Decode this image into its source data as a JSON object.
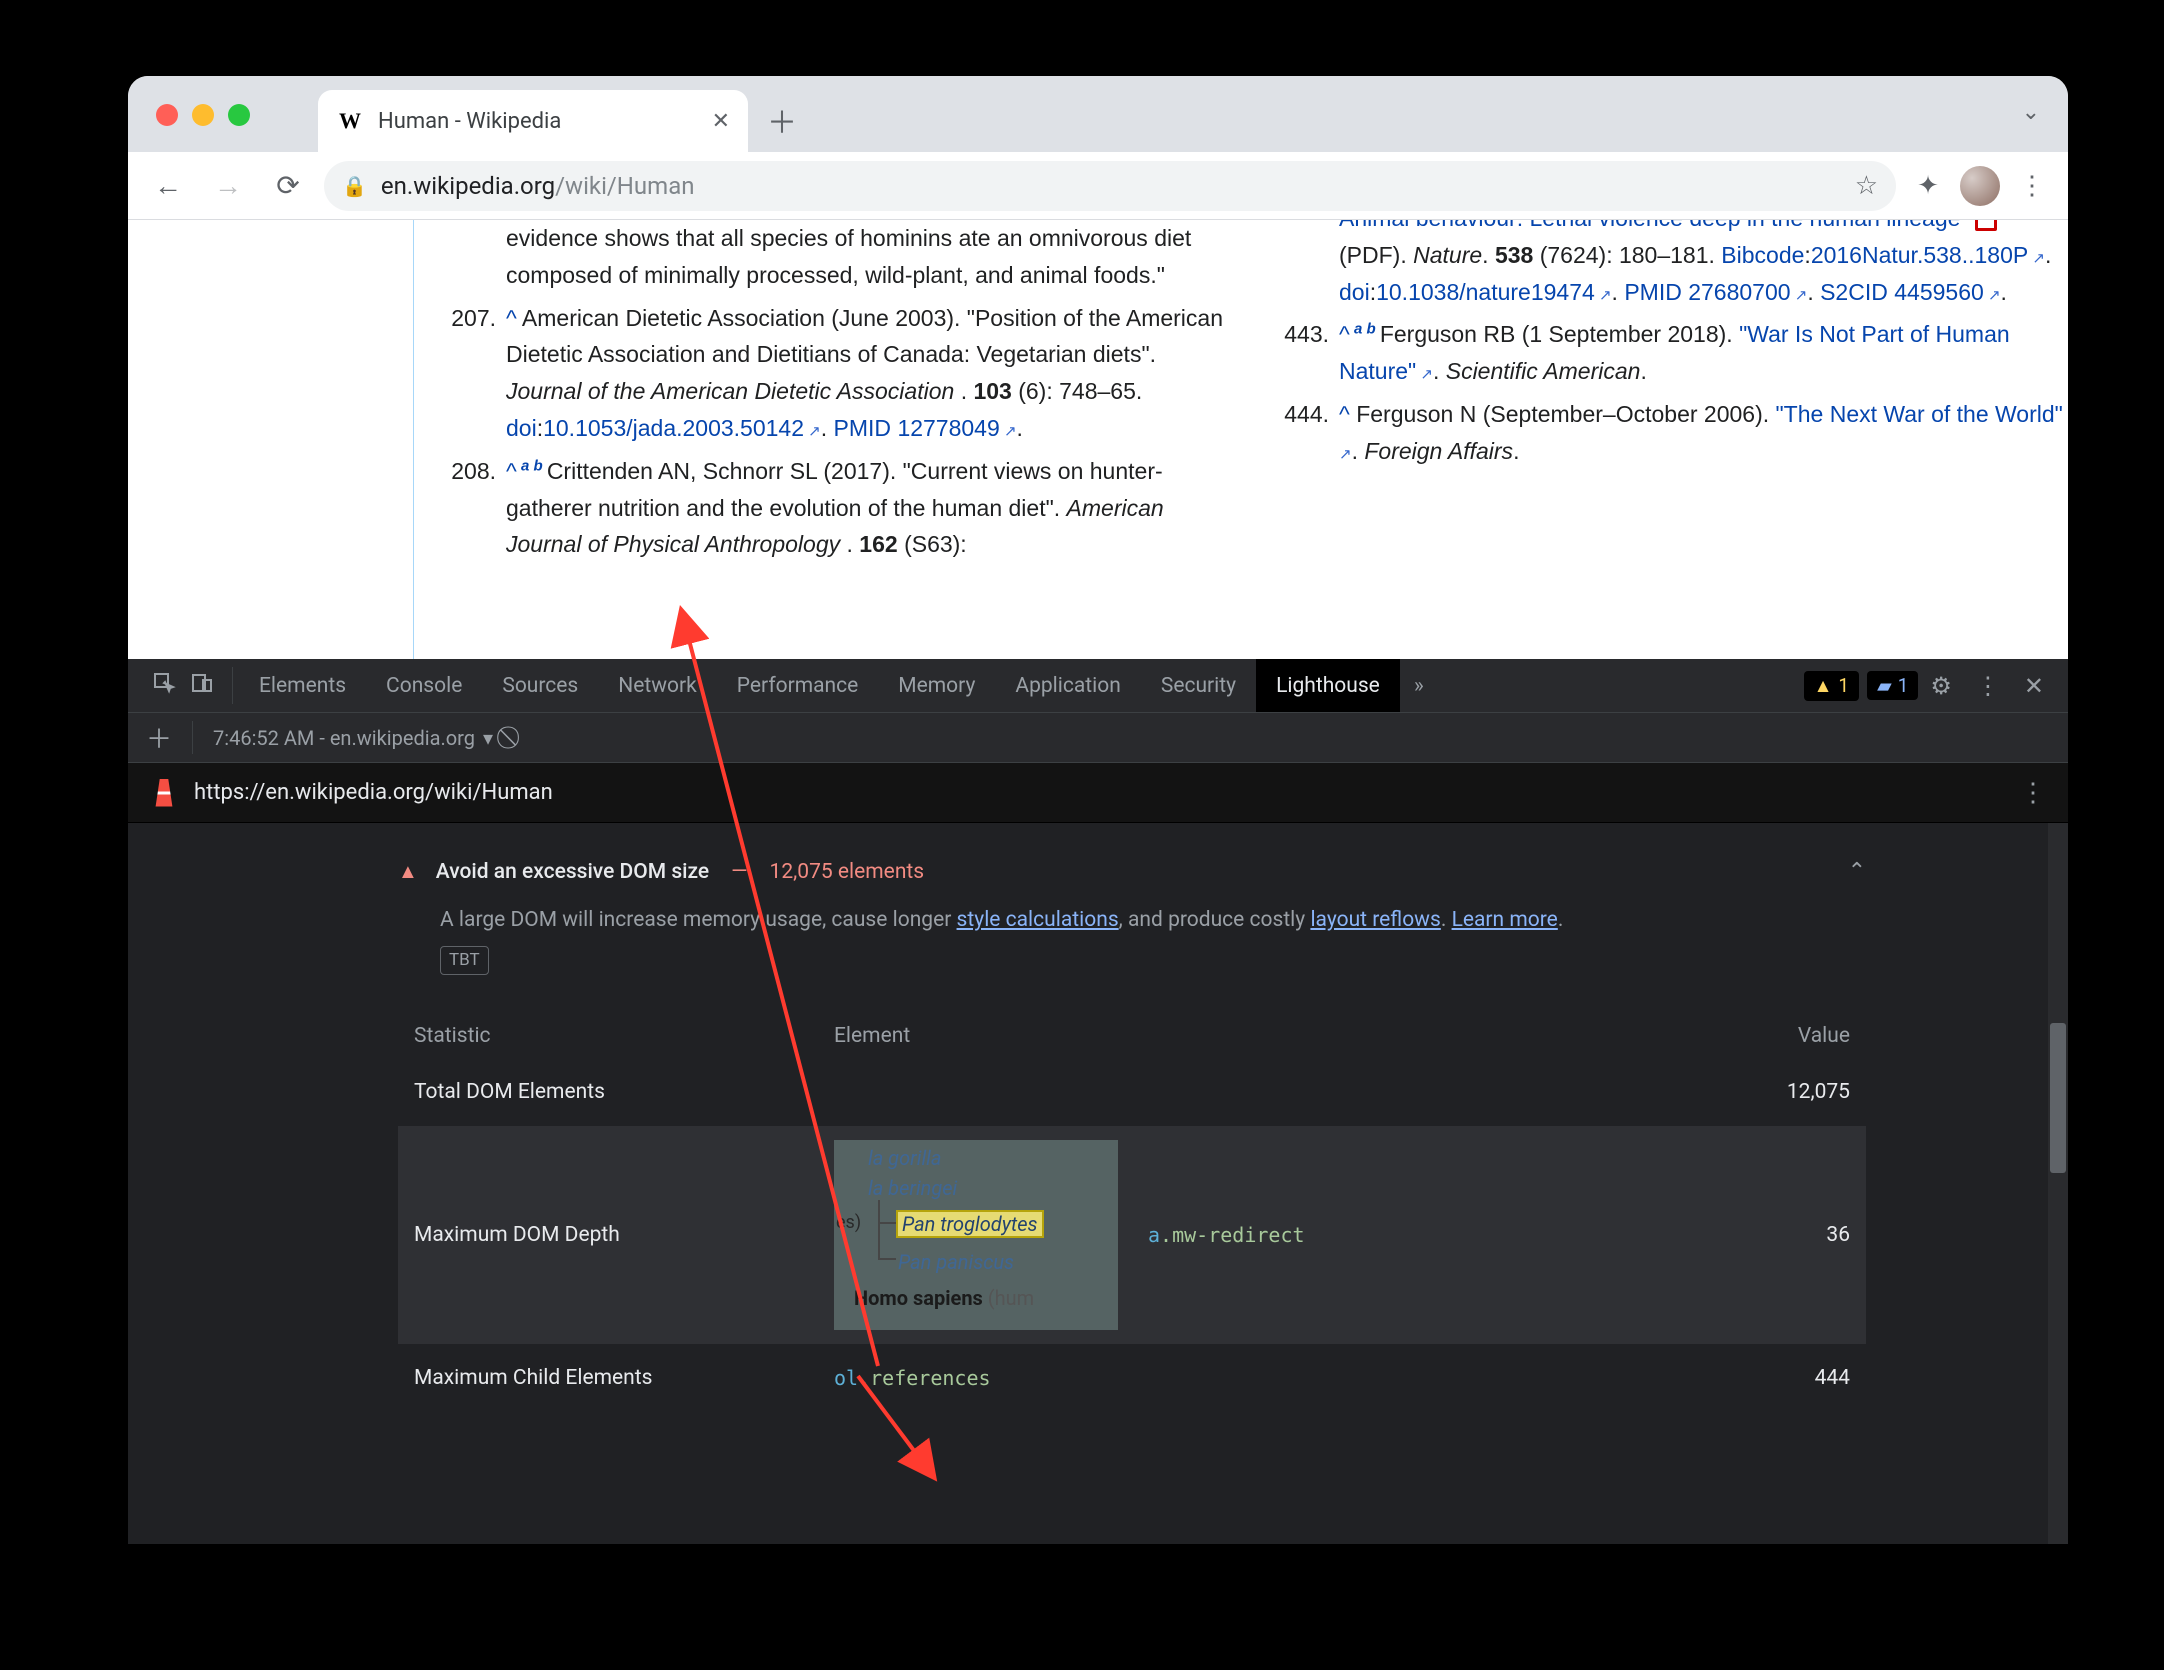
{
  "browser": {
    "tab_title": "Human - Wikipedia",
    "url_host": "en.wikipedia.org",
    "url_path": "/wiki/Human"
  },
  "wiki": {
    "left": [
      {
        "num": "",
        "text_initial": "evidence shows that all species of hominins ate an omnivorous diet composed of minimally processed, wild-plant, and animal foods.\""
      },
      {
        "num": "207.",
        "caret": "^",
        "body_a": " American Dietetic Association (June 2003). \"Position of the American Dietetic Association and Dietitians of Canada: Vegetarian diets\". ",
        "journal": "Journal of the American Dietetic Association",
        "body_b": ". ",
        "vol": "103",
        "issue_pages": " (6): 748–65. ",
        "doi_label": "doi",
        "doi_val": "10.1053/jada.2003.50142",
        "pmid_label": "PMID",
        "pmid_val": "12778049"
      },
      {
        "num": "208.",
        "caret": "^",
        "sup": " a b ",
        "body_a": "Crittenden AN, Schnorr SL (2017). \"Current views on hunter-gatherer nutrition and the evolution of the human diet\". ",
        "journal": "American Journal of Physical Anthropology",
        "body_b": ". ",
        "vol": "162",
        "issue_pages": " (S63):"
      }
    ],
    "right": [
      {
        "link1": "Animal behaviour: Lethal violence deep in the human lineage\"",
        "pdf": " (PDF). ",
        "journal": "Nature",
        "vol": "538",
        "pages": " (7624): 180–181. ",
        "bibcode_label": "Bibcode",
        "bibcode_val": "2016Natur.538..180P",
        "doi_label": "doi",
        "doi_val": "10.1038/nature19474",
        "pmid_label": "PMID",
        "pmid_val": "27680700",
        "s2cid_label": "S2CID",
        "s2cid_val": "4459560"
      },
      {
        "num": "443.",
        "caret": "^",
        "sup": " a b ",
        "author": "Ferguson RB (1 September 2018). ",
        "link": "\"War Is Not Part of Human Nature\"",
        "journal": "Scientific American"
      },
      {
        "num": "444.",
        "caret": "^",
        "author": " Ferguson N (September–October 2006). ",
        "link": "\"The Next War of the World\"",
        "journal": "Foreign Affairs"
      }
    ]
  },
  "devtools": {
    "tabs": [
      "Elements",
      "Console",
      "Sources",
      "Network",
      "Performance",
      "Memory",
      "Application",
      "Security",
      "Lighthouse"
    ],
    "active_tab": "Lighthouse",
    "warn_count": "1",
    "info_count": "1",
    "report_label": "7:46:52 AM - en.wikipedia.org",
    "lh_url": "https://en.wikipedia.org/wiki/Human",
    "audit": {
      "title": "Avoid an excessive DOM size",
      "metric": "12,075 elements",
      "desc_a": "A large DOM will increase memory usage, cause longer ",
      "link1": "style calculations",
      "desc_b": ", and produce costly ",
      "link2": "layout reflows",
      "desc_c": ". ",
      "link3": "Learn more",
      "tbt": "TBT",
      "headers": {
        "c1": "Statistic",
        "c2": "Element",
        "c3": "Value"
      },
      "rows": [
        {
          "stat": "Total DOM Elements",
          "elem_html": "",
          "value": "12,075"
        },
        {
          "stat": "Maximum DOM Depth",
          "elem_sel_tag": "a",
          "elem_sel_cls": ".mw-redirect",
          "value": "36",
          "thumb": true
        },
        {
          "stat": "Maximum Child Elements",
          "elem_sel_tag": "ol",
          "elem_sel_cls": ".references",
          "value": "444"
        }
      ],
      "thumb_lines": {
        "l1": "la gorilla",
        "l2": "la beringei",
        "l3": "Pan troglodytes",
        "l4": "Pan paniscus",
        "l5a": "Homo sapiens",
        "l5b": " (hum",
        "l6": "es)"
      }
    }
  }
}
